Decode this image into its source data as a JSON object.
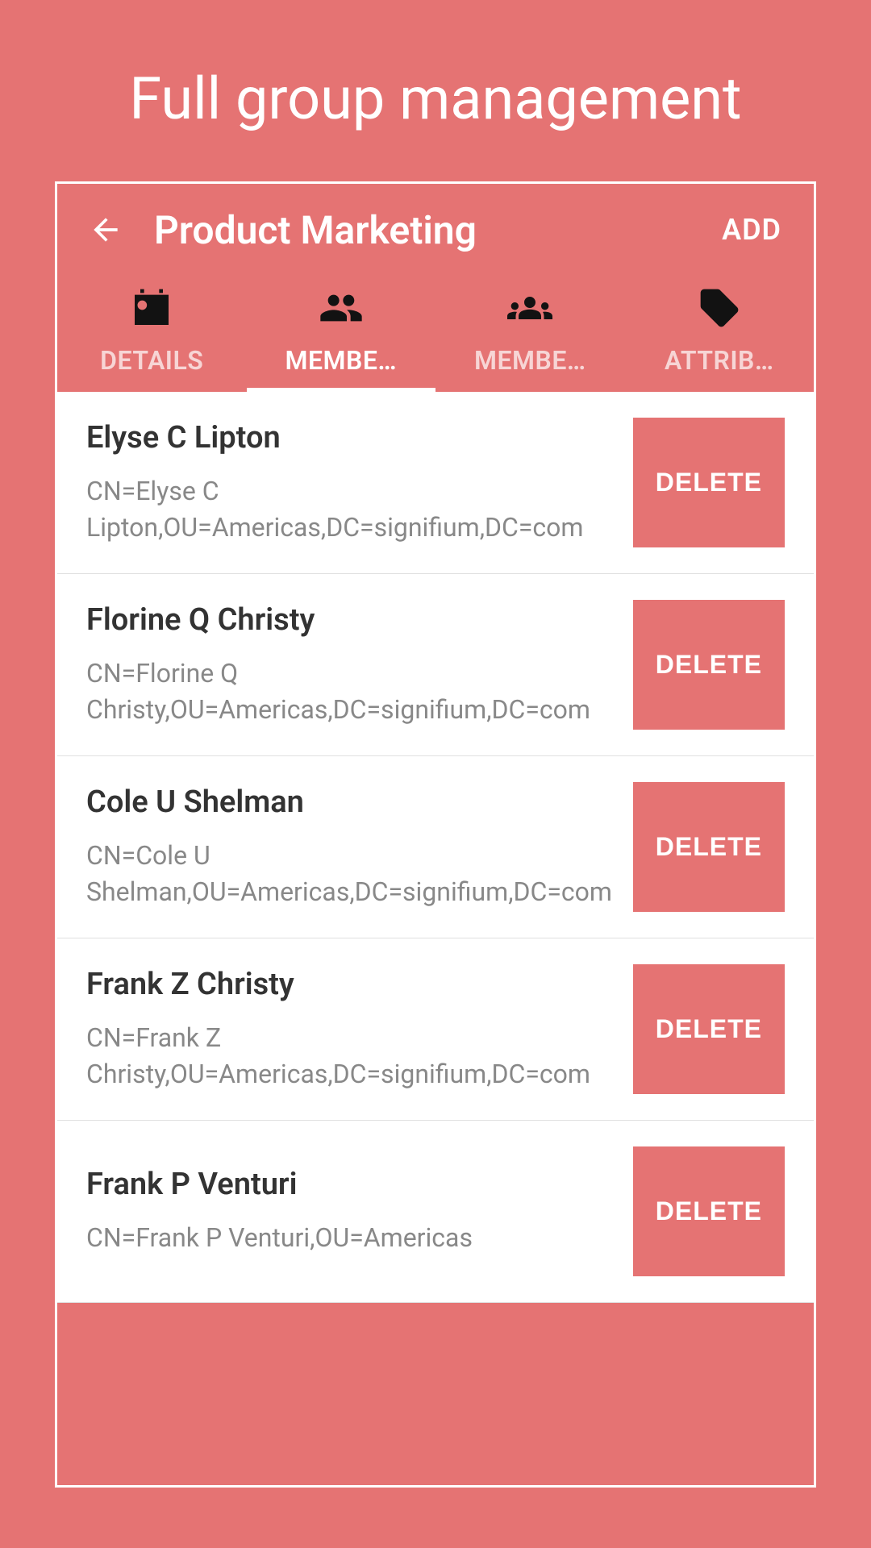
{
  "promo": {
    "title": "Full group management"
  },
  "header": {
    "title": "Product Marketing",
    "add_label": "ADD"
  },
  "tabs": [
    {
      "label": "DETAILS",
      "icon": "id-card"
    },
    {
      "label": "MEMBE…",
      "icon": "people",
      "active": true
    },
    {
      "label": "MEMBE…",
      "icon": "groups"
    },
    {
      "label": "ATTRIB…",
      "icon": "tags"
    }
  ],
  "buttons": {
    "delete_label": "DELETE"
  },
  "members": [
    {
      "name": "Elyse C Lipton",
      "dn": "CN=Elyse C Lipton,OU=Americas,DC=signifium,DC=com"
    },
    {
      "name": "Florine Q Christy",
      "dn": "CN=Florine Q Christy,OU=Americas,DC=signifium,DC=com"
    },
    {
      "name": "Cole U Shelman",
      "dn": "CN=Cole U Shelman,OU=Americas,DC=signifium,DC=com"
    },
    {
      "name": "Frank Z Christy",
      "dn": "CN=Frank Z Christy,OU=Americas,DC=signifium,DC=com"
    },
    {
      "name": "Frank P Venturi",
      "dn": "CN=Frank P Venturi,OU=Americas"
    }
  ]
}
